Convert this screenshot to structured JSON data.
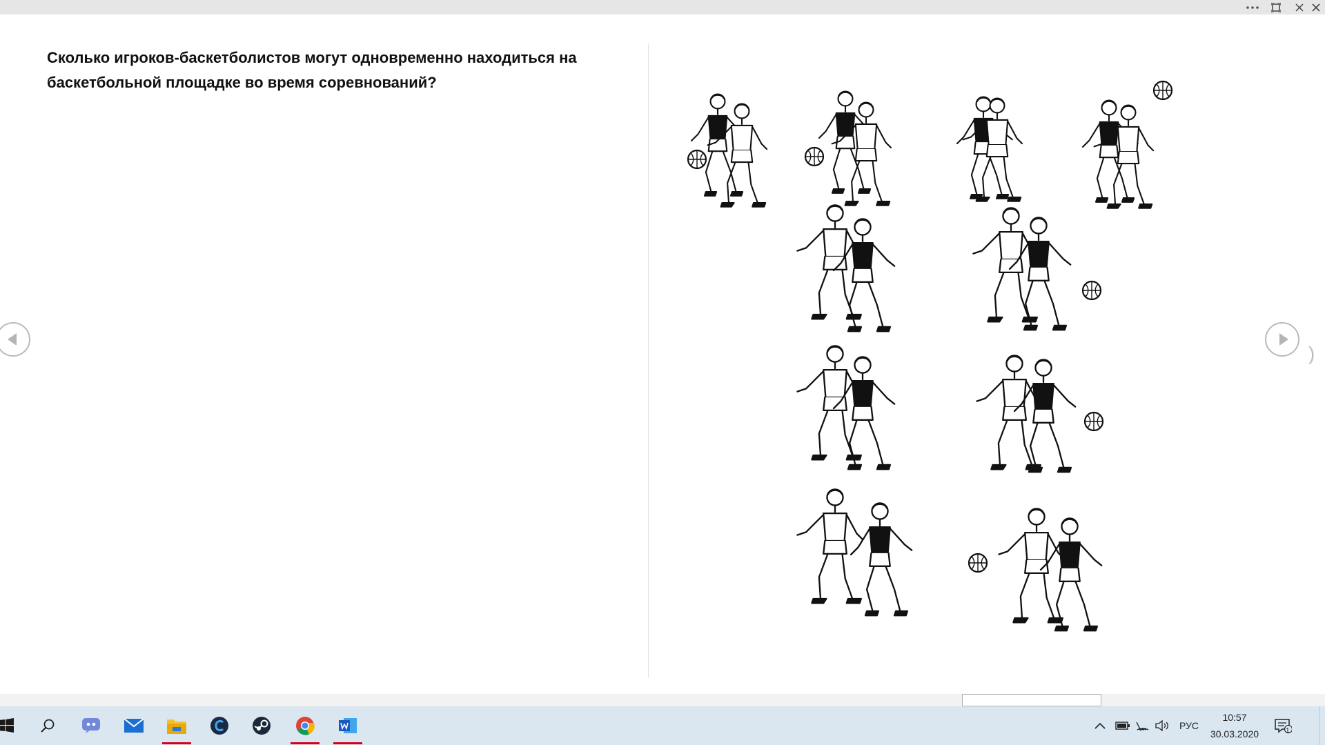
{
  "window": {
    "more_icon": "ellipsis-icon",
    "fit_icon": "fit-screen-icon",
    "close_icon": "close-icon"
  },
  "slide": {
    "question": "Сколько игроков-баскетболистов могут одновременно находиться на баскетбольной площадке во время соревнований?",
    "illustration": "basketball-players-illustration"
  },
  "navigation": {
    "prev_icon": "chevron-left-icon",
    "next_icon": "chevron-right-icon"
  },
  "taskbar": {
    "apps": [
      "start-icon",
      "search-icon",
      "discord-icon",
      "mail-icon",
      "file-explorer-icon",
      "ccleaner-icon",
      "steam-icon",
      "chrome-icon",
      "word-icon"
    ],
    "language": "РУС",
    "time": "10:57",
    "date": "30.03.2020",
    "notifications": "1"
  },
  "colors": {
    "taskbar": "#dbe7f0",
    "running_indicator": "#d6001c",
    "titlebar": "#e6e6e6"
  }
}
